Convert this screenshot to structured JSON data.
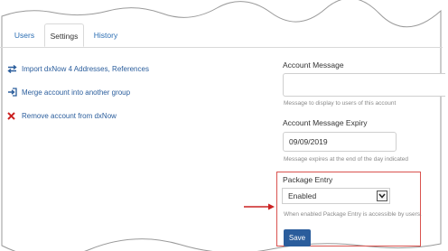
{
  "tabs": [
    {
      "label": "Users"
    },
    {
      "label": "Settings"
    },
    {
      "label": "History"
    }
  ],
  "actions": [
    {
      "label": "Import dxNow 4 Addresses, References",
      "icon": "swap-arrows-icon"
    },
    {
      "label": "Merge account into another group",
      "icon": "sign-in-icon"
    },
    {
      "label": "Remove account from dxNow",
      "icon": "close-x-icon"
    }
  ],
  "account_message": {
    "label": "Account Message",
    "value": "",
    "help": "Message to display to users of this account"
  },
  "account_message_expiry": {
    "label": "Account Message Expiry",
    "value": "09/09/2019",
    "help": "Message expires at the end of the day indicated"
  },
  "package_entry": {
    "label": "Package Entry",
    "selected": "Enabled",
    "help": "When enabled Package Entry is accessible by users."
  },
  "save_label": "Save",
  "colors": {
    "link": "#2a6db3",
    "primary_button": "#2a5d9c",
    "highlight_border": "#d9534f",
    "remove_icon": "#cc2222"
  }
}
